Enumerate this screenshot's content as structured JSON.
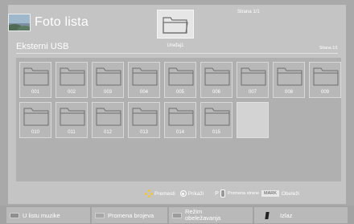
{
  "header": {
    "title": "Foto lista",
    "page_indicator": "Strana 1/1",
    "source": "Eksterni USB",
    "device_label": "Uređaj1",
    "page_indicator_small": "Strana 1/1"
  },
  "folders": [
    {
      "label": "001"
    },
    {
      "label": "002"
    },
    {
      "label": "003"
    },
    {
      "label": "004"
    },
    {
      "label": "005"
    },
    {
      "label": "006"
    },
    {
      "label": "007"
    },
    {
      "label": "008"
    },
    {
      "label": "009"
    },
    {
      "label": "010"
    },
    {
      "label": "011"
    },
    {
      "label": "012"
    },
    {
      "label": "013"
    },
    {
      "label": "014"
    },
    {
      "label": "015"
    }
  ],
  "hints": {
    "move": "Premesti",
    "show": "Prikaži",
    "page_key": "P",
    "page_change": "Promena strane",
    "mark_key": "MARK",
    "mark": "Obeleži"
  },
  "buttons": {
    "music": "U listu muzike",
    "numbers": "Promena brojeva",
    "mark_mode_line1": "Režim",
    "mark_mode_line2": "obeležavanja",
    "exit": "Izlaz"
  },
  "colors": {
    "red_key": "#8f8f8f",
    "green_key": "#a8a8a8",
    "yellow_key": "#9c9c9c",
    "blue_key": "#222222",
    "move_arrows": "#f3c637"
  }
}
